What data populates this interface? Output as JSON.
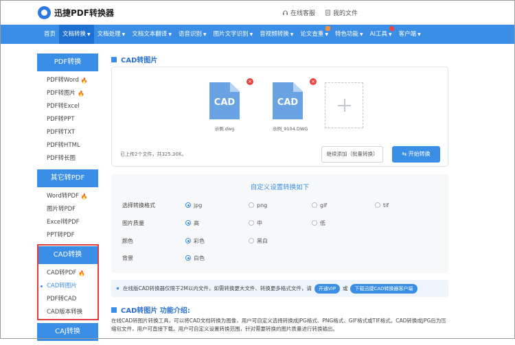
{
  "header": {
    "logo_text": "迅捷PDF转换器",
    "support_label": "在线客服",
    "myfiles_label": "我的文件"
  },
  "nav": {
    "items": [
      {
        "label": "首页",
        "caret": false
      },
      {
        "label": "文档转换",
        "caret": true,
        "active": true
      },
      {
        "label": "文档处理",
        "caret": true
      },
      {
        "label": "文档文本翻译",
        "caret": true
      },
      {
        "label": "语音识别",
        "caret": true
      },
      {
        "label": "图片文字识别",
        "caret": true
      },
      {
        "label": "音视频转换",
        "caret": true
      },
      {
        "label": "论文查重",
        "caret": true,
        "badge": "new"
      },
      {
        "label": "特色功能",
        "caret": true
      },
      {
        "label": "AI工具",
        "caret": true,
        "badge": "hot"
      },
      {
        "label": "客户端",
        "caret": true
      }
    ]
  },
  "sidebar": {
    "groups": [
      {
        "title": "PDF转换",
        "items": [
          {
            "label": "PDF转Word",
            "hot": true
          },
          {
            "label": "PDF转图片",
            "hot": true
          },
          {
            "label": "PDF转Excel"
          },
          {
            "label": "PDF转PPT"
          },
          {
            "label": "PDF转TXT"
          },
          {
            "label": "PDF转HTML"
          },
          {
            "label": "PDF转长图"
          }
        ]
      },
      {
        "title": "其它转PDF",
        "items": [
          {
            "label": "Word转PDF",
            "hot": true
          },
          {
            "label": "图片转PDF"
          },
          {
            "label": "Excel转PDF"
          },
          {
            "label": "PPT转PDF"
          }
        ]
      },
      {
        "title": "CAD转换",
        "items": [
          {
            "label": "CAD转PDF",
            "hot": true
          },
          {
            "label": "CAD转图片",
            "current": true
          },
          {
            "label": "PDF转CAD"
          },
          {
            "label": "CAD版本转换"
          }
        ]
      },
      {
        "title": "CAJ转换",
        "items": []
      }
    ],
    "flame_glyph": "🔥"
  },
  "main": {
    "title": "CAD转图片",
    "files": [
      {
        "icon_text": "CAD",
        "name": "示例.dwg"
      },
      {
        "icon_text": "CAD",
        "name": "示例_9104.DWG"
      }
    ],
    "upload_status": "已上传2个文件，共325.30K。",
    "continue_label": "继续添加（批量转换）",
    "start_label": "开始转换",
    "close_glyph": "×"
  },
  "settings": {
    "title": "自定义设置转换如下",
    "rows": [
      {
        "label": "选择转换格式",
        "options": [
          {
            "label": "jpg",
            "selected": true
          },
          {
            "label": "png",
            "selected": false
          },
          {
            "label": "gif",
            "selected": false
          },
          {
            "label": "tif",
            "selected": false
          }
        ]
      },
      {
        "label": "图片质量",
        "options": [
          {
            "label": "高",
            "selected": true
          },
          {
            "label": "中",
            "selected": false
          },
          {
            "label": "低",
            "selected": false
          }
        ]
      },
      {
        "label": "颜色",
        "options": [
          {
            "label": "彩色",
            "selected": true
          },
          {
            "label": "黑白",
            "selected": false
          }
        ]
      },
      {
        "label": "背景",
        "options": [
          {
            "label": "白色",
            "selected": true
          }
        ]
      }
    ]
  },
  "notice": {
    "text": "在线版CAD转换器仅限于2M以内文件，如需转换更大文件、转换更多格式文件，请",
    "vip_label": "开通VIP",
    "or_text": "或",
    "client_label": "下载迅捷CAD转换器客户端"
  },
  "intro": {
    "title": "CAD转图片 功能介绍:",
    "body": "在线CAD转图片转换工具，可以将CAD文档转换为图像，用户可自定义选择转换成JPG格式、PNG格式、GIF格式或TIF格式。CAD转换成JPG后为压缩包文件，用户可直接下载。用户可自定义设置转换范围，针对需要转换的图片质量进行转换输出。"
  },
  "colors": {
    "accent": "#3a8ee6",
    "nav_active": "#1d6fd1",
    "highlight_border": "#e23b3b",
    "close_red": "#e8453c"
  }
}
